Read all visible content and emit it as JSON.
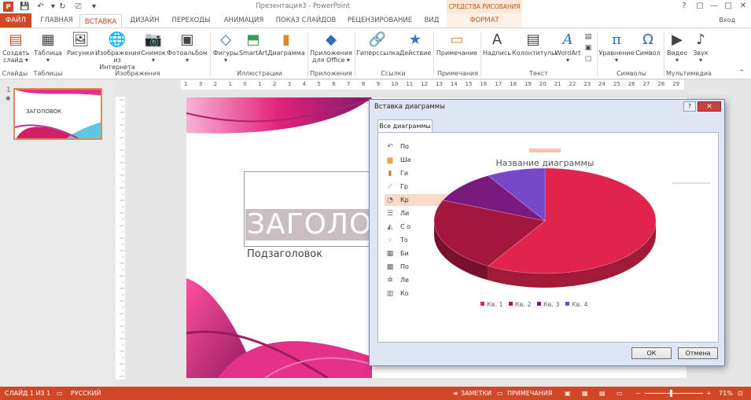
{
  "titlebar": {
    "app_logo": "P",
    "title": "Презентация3 - PowerPoint",
    "context_group": "СРЕДСТВА РИСОВАНИЯ",
    "signin": "Вход",
    "qat_icons": [
      "save-icon",
      "undo-icon",
      "redo-icon",
      "start-from-beginning-icon",
      "customize-qat-icon"
    ],
    "window_buttons": [
      "?",
      "▢",
      "—",
      "□",
      "✕"
    ]
  },
  "tabs": [
    "ФАЙЛ",
    "ГЛАВНАЯ",
    "ВСТАВКА",
    "ДИЗАЙН",
    "ПЕРЕХОДЫ",
    "АНИМАЦИЯ",
    "ПОКАЗ СЛАЙДОВ",
    "РЕЦЕНЗИРОВАНИЕ",
    "ВИД",
    "ФОРМАТ"
  ],
  "ribbon": {
    "buttons": [
      {
        "label": "Создать",
        "label2": "слайд ▾",
        "icon": "▤"
      },
      {
        "label": "Таблица",
        "label2": "▾",
        "icon": "▦"
      },
      {
        "label": "Рисунки",
        "label2": "",
        "icon": "🖼"
      },
      {
        "label": "Изображения",
        "label2": "из Интернета",
        "icon": "🌐"
      },
      {
        "label": "Снимок",
        "label2": "▾",
        "icon": "📷"
      },
      {
        "label": "Фотоальбом",
        "label2": "▾",
        "icon": "▣"
      },
      {
        "label": "Фигуры",
        "label2": "▾",
        "icon": "◇"
      },
      {
        "label": "SmartArt",
        "label2": "",
        "icon": "⬒"
      },
      {
        "label": "Диаграмма",
        "label2": "",
        "icon": "▮"
      },
      {
        "label": "Приложения",
        "label2": "для Office ▾",
        "icon": "◆"
      },
      {
        "label": "Гиперссылка",
        "label2": "",
        "icon": "🔗"
      },
      {
        "label": "Действие",
        "label2": "",
        "icon": "★"
      },
      {
        "label": "Примечание",
        "label2": "",
        "icon": "▭"
      },
      {
        "label": "Надпись",
        "label2": "",
        "icon": "A"
      },
      {
        "label": "Колонтитулы",
        "label2": "",
        "icon": "▤"
      },
      {
        "label": "WordArt",
        "label2": "▾",
        "icon": "A"
      },
      {
        "label": "Уравнение",
        "label2": "▾",
        "icon": "π"
      },
      {
        "label": "Символ",
        "label2": "",
        "icon": "Ω"
      },
      {
        "label": "Видео",
        "label2": "▾",
        "icon": "▶"
      },
      {
        "label": "Звук",
        "label2": "▾",
        "icon": "♪"
      }
    ],
    "groups": [
      "Слайды",
      "Таблицы",
      "Изображения",
      "Иллюстрации",
      "Приложения",
      "Ссылки",
      "Примечания",
      "Текст",
      "Символы",
      "Мультимедиа"
    ]
  },
  "thumbs": {
    "number": "1",
    "star": "✱",
    "title": "ЗАГОЛОВОК"
  },
  "ruler": {
    "labels": [
      "1",
      "3",
      "2",
      "1",
      "0",
      "1",
      "2",
      "3",
      "4",
      "5",
      "6",
      "7",
      "8",
      "9",
      "10",
      "11",
      "12",
      "13",
      "14",
      "15",
      "16",
      "17",
      "18",
      "19",
      "20",
      "21",
      "22",
      "23",
      "24",
      "25",
      "26",
      "27",
      "28",
      "29"
    ]
  },
  "slide": {
    "title": "ЗАГОЛОВОК",
    "subtitle": "Подзаголовок"
  },
  "dialog": {
    "title": "Вставка диаграммы",
    "tab": "Все диаграммы",
    "chart_types": [
      "По",
      "Ша",
      "Ги",
      "Гр",
      "Кр",
      "Ли",
      "С о",
      "То",
      "Би",
      "По",
      "Ле",
      "Ко"
    ],
    "selected_index": 4,
    "ok": "ОК",
    "cancel": "Отмена",
    "help": "?",
    "close": "✕"
  },
  "chart_data": {
    "type": "pie",
    "title": "Название диаграммы",
    "categories": [
      "Кв. 1",
      "Кв. 2",
      "Кв. 3",
      "Кв. 4"
    ],
    "values": [
      8.2,
      3.2,
      1.4,
      1.2
    ],
    "colors": [
      "#e0244e",
      "#a5163f",
      "#7b1a7e",
      "#7448c9"
    ],
    "legend": "bottom",
    "style": "3d"
  },
  "status": {
    "slide": "СЛАЙД 1 ИЗ 1",
    "lang": "РУССКИЙ",
    "notes": "ЗАМЕТКИ",
    "comments": "ПРИМЕЧАНИЯ",
    "zoom": "71%"
  }
}
